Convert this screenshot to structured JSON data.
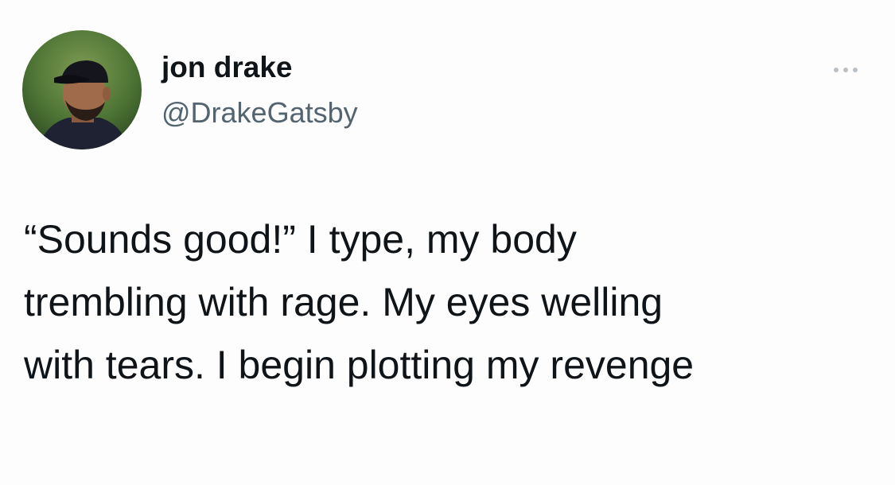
{
  "tweet": {
    "author": {
      "name": "jon drake",
      "handle": "@DrakeGatsby",
      "avatar_icon": "profile-photo-man-in-cap"
    },
    "more_icon": "more-options-icon",
    "text_lines": [
      "“Sounds good!” I type, my body",
      "trembling with rage. My eyes welling",
      "with tears. I begin plotting my revenge"
    ]
  },
  "colors": {
    "name": "#0f1419",
    "handle": "#536471",
    "text": "#0f1419",
    "more_icon": "#b9c1c8"
  }
}
